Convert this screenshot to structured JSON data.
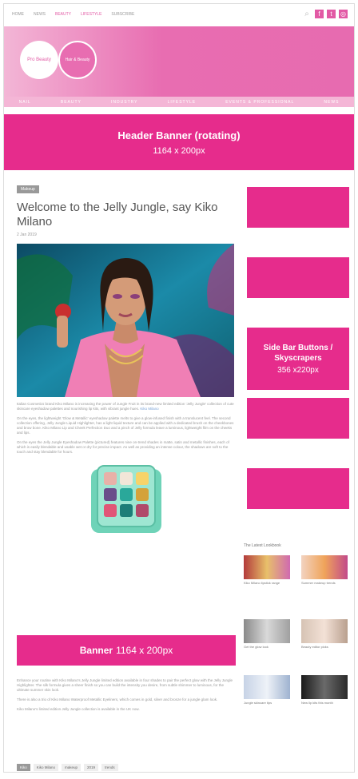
{
  "topnav": {
    "items": [
      "HOME",
      "NEWS",
      "BEAUTY",
      "LIFESTYLE",
      "SUBSCRIBE"
    ]
  },
  "hero": {
    "logo_text": "Pro Beauty",
    "logo2_text": "Hair & Beauty"
  },
  "subnav": {
    "items": [
      "NAIL",
      "BEAUTY",
      "INDUSTRY",
      "LIFESTYLE",
      "EVENTS & PROFESSIONAL",
      "NEWS"
    ]
  },
  "header_banner": {
    "title": "Header Banner (rotating)",
    "dims": "1164 x 200px"
  },
  "article": {
    "category": "Makeup",
    "title": "Welcome to the Jelly Jungle, say Kiko Milano",
    "date": "2 Jan 2019",
    "para1": "Italian Cosmetics brand Kiko Milano is increasing the power of Jungle Fruit in its brand-new limited edition 'Jelly Jungle' collection of cute skincare eyeshadow palettes and nourishing lip kits, with vibrant jungle hues.",
    "link": "Kiko Milano",
    "para2": "On the eyes, the lightweight 'Glow & Metallic' eyeshadow palette melts to give a glow-infused finish with a translucent feel. The second collection offering, Jelly Jungle Liquid Highlighter, has a light liquid texture and can be applied with a dedicated brush on the cheekbones and brow bone. Kiko Milano Lip and Cheek Perfection Duo and a pinch of Jelly formula leave a luminous, lightweight film on the cheeks and lips.",
    "para3": "On the eyes the Jelly Jungle Eyeshadow Palette (pictured) features nine on-trend shades in matte, satin and metallic finishes, each of which is easily blendable and usable wet or dry for precise impact. As well as providing an intense colour, the shadows are soft to the touch and stay blendable for hours.",
    "para4": "Enhance your routine with Kiko Milano's Jelly Jungle limited edition available in four shades to pair the perfect glow with the Jelly Jungle Highlighter. The silk formula gives a sheer finish so you can build the intensity you desire, from subtle shimmer to luminous, for the ultimate summer skin look.",
    "para5": "There is also a trio of Kiko Milano Waterproof Metallic Eyeliners, which comes in gold, silver and bronze for a jungle glam look.",
    "para6": "Kiko Milano's limited edition Jelly Jungle collection is available in the UK now.",
    "tags": [
      "Kiko",
      "Kiko Milano",
      "makeup",
      "2019",
      "trends"
    ]
  },
  "banner": {
    "title": "Banner",
    "dims": "1164 x 200px"
  },
  "sidebar": {
    "title": "Side Bar Buttons / Skyscrapers",
    "dims": "356 x220px",
    "latest_label": "The Latest Lookbook",
    "thumbs": [
      "Kiko Milano lipstick range",
      "Summer makeup trends",
      "Get the glow look",
      "Beauty editor picks",
      "Jungle skincare tips",
      "New lip kits this month"
    ]
  },
  "colors": {
    "brand_pink": "#e62c8c",
    "hero_pink": "#e86db1"
  }
}
